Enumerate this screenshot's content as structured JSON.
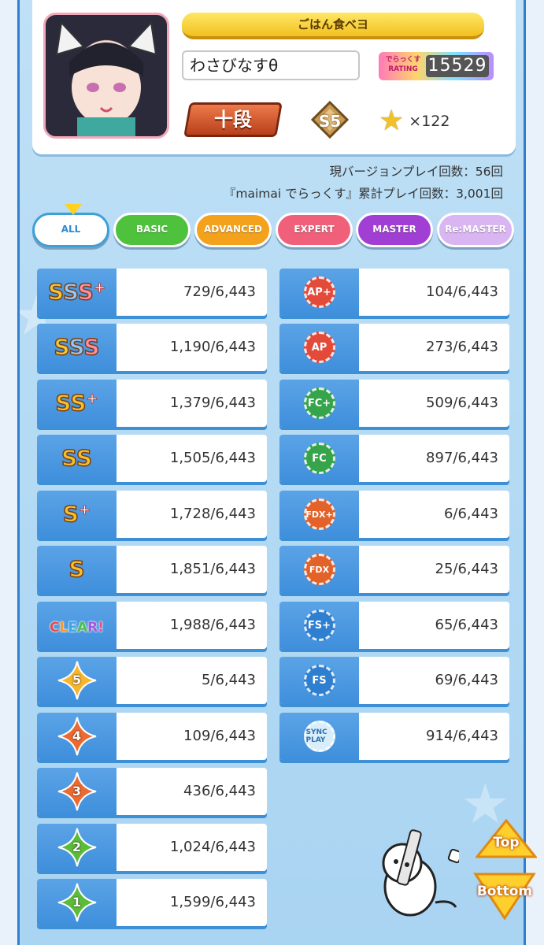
{
  "profile": {
    "title": "ごはん食べヨ",
    "player_name": "わさびなすθ",
    "rating_label_top": "でらっくす",
    "rating_label_bottom": "RATING",
    "rating_value": "15529",
    "dan": "十段",
    "season": "S5",
    "star_count": "×122"
  },
  "play_counts": {
    "current_version": "現バージョンプレイ回数：56回",
    "total": "『maimai でらっくす』累計プレイ回数：3,001回"
  },
  "tabs": [
    {
      "label": "ALL",
      "color": "#ffffff"
    },
    {
      "label": "BASIC",
      "color": "#4ec23c"
    },
    {
      "label": "ADVANCED",
      "color": "#f4a21c"
    },
    {
      "label": "EXPERT",
      "color": "#f0607a"
    },
    {
      "label": "MASTER",
      "color": "#a13fd4"
    },
    {
      "label": "Re:MASTER",
      "color": "#d9b5f2"
    }
  ],
  "left_stats": [
    {
      "badge": "SSS+",
      "value": "729/6,443"
    },
    {
      "badge": "SSS",
      "value": "1,190/6,443"
    },
    {
      "badge": "SS+",
      "value": "1,379/6,443"
    },
    {
      "badge": "SS",
      "value": "1,505/6,443"
    },
    {
      "badge": "S+",
      "value": "1,728/6,443"
    },
    {
      "badge": "S",
      "value": "1,851/6,443"
    },
    {
      "badge": "CLEAR!",
      "value": "1,988/6,443"
    },
    {
      "badge": "5",
      "value": "5/6,443"
    },
    {
      "badge": "4",
      "value": "109/6,443"
    },
    {
      "badge": "3",
      "value": "436/6,443"
    },
    {
      "badge": "2",
      "value": "1,024/6,443"
    },
    {
      "badge": "1",
      "value": "1,599/6,443"
    }
  ],
  "right_stats": [
    {
      "badge": "AP+",
      "value": "104/6,443"
    },
    {
      "badge": "AP",
      "value": "273/6,443"
    },
    {
      "badge": "FC+",
      "value": "509/6,443"
    },
    {
      "badge": "FC",
      "value": "897/6,443"
    },
    {
      "badge": "FDX+",
      "value": "6/6,443"
    },
    {
      "badge": "FDX",
      "value": "25/6,443"
    },
    {
      "badge": "FS+",
      "value": "65/6,443"
    },
    {
      "badge": "FS",
      "value": "69/6,443"
    },
    {
      "badge": "SYNC PLAY",
      "value": "914/6,443"
    }
  ],
  "nav": {
    "top": "Top",
    "bottom": "Bottom"
  },
  "icons": {
    "avatar": "catgirl-avatar",
    "dan": "dan-plate",
    "season": "season-diamond-icon",
    "star": "star-icon",
    "mascot": "mascot-icon"
  }
}
